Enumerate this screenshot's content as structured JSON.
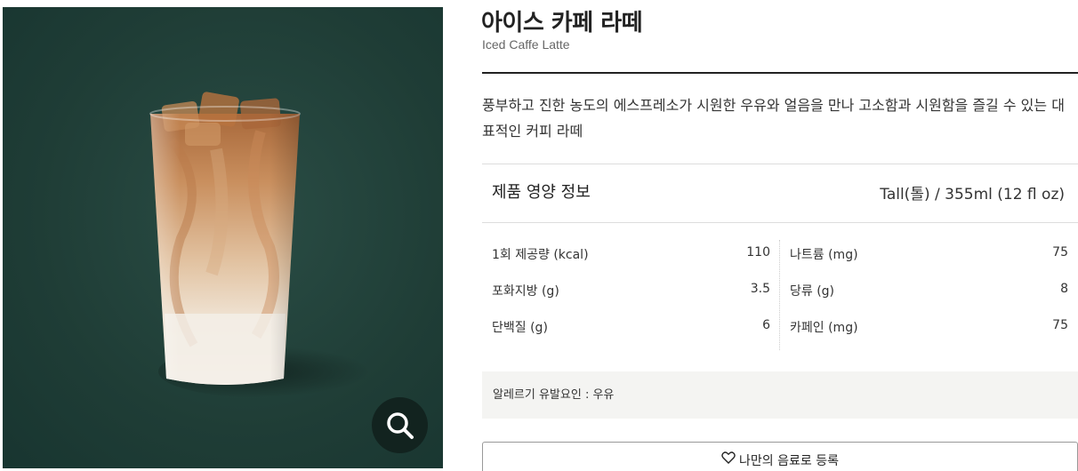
{
  "product": {
    "title_ko": "아이스 카페 라떼",
    "title_en": "Iced Caffe Latte",
    "description": "풍부하고 진한 농도의 에스프레소가 시원한 우유와 얼음을 만나 고소함과 시원함을 즐길 수 있는 대표적인 커피 라떼"
  },
  "nutrition": {
    "heading": "제품 영양 정보",
    "size": "Tall(톨) / 355ml (12 fl oz)",
    "left": [
      {
        "label": "1회 제공량 (kcal)",
        "value": "110"
      },
      {
        "label": "포화지방 (g)",
        "value": "3.5"
      },
      {
        "label": "단백질 (g)",
        "value": "6"
      }
    ],
    "right": [
      {
        "label": "나트륨 (mg)",
        "value": "75"
      },
      {
        "label": "당류 (g)",
        "value": "8"
      },
      {
        "label": "카페인 (mg)",
        "value": "75"
      }
    ]
  },
  "allergy": {
    "text": "알레르기 유발요인 : 우유"
  },
  "actions": {
    "favorite_label": "나만의 음료로 등록"
  },
  "icons": {
    "zoom": "search-icon",
    "favorite": "heart-icon"
  },
  "colors": {
    "photo_bg": "#1f3f38",
    "zoom_button": "#12231f"
  }
}
